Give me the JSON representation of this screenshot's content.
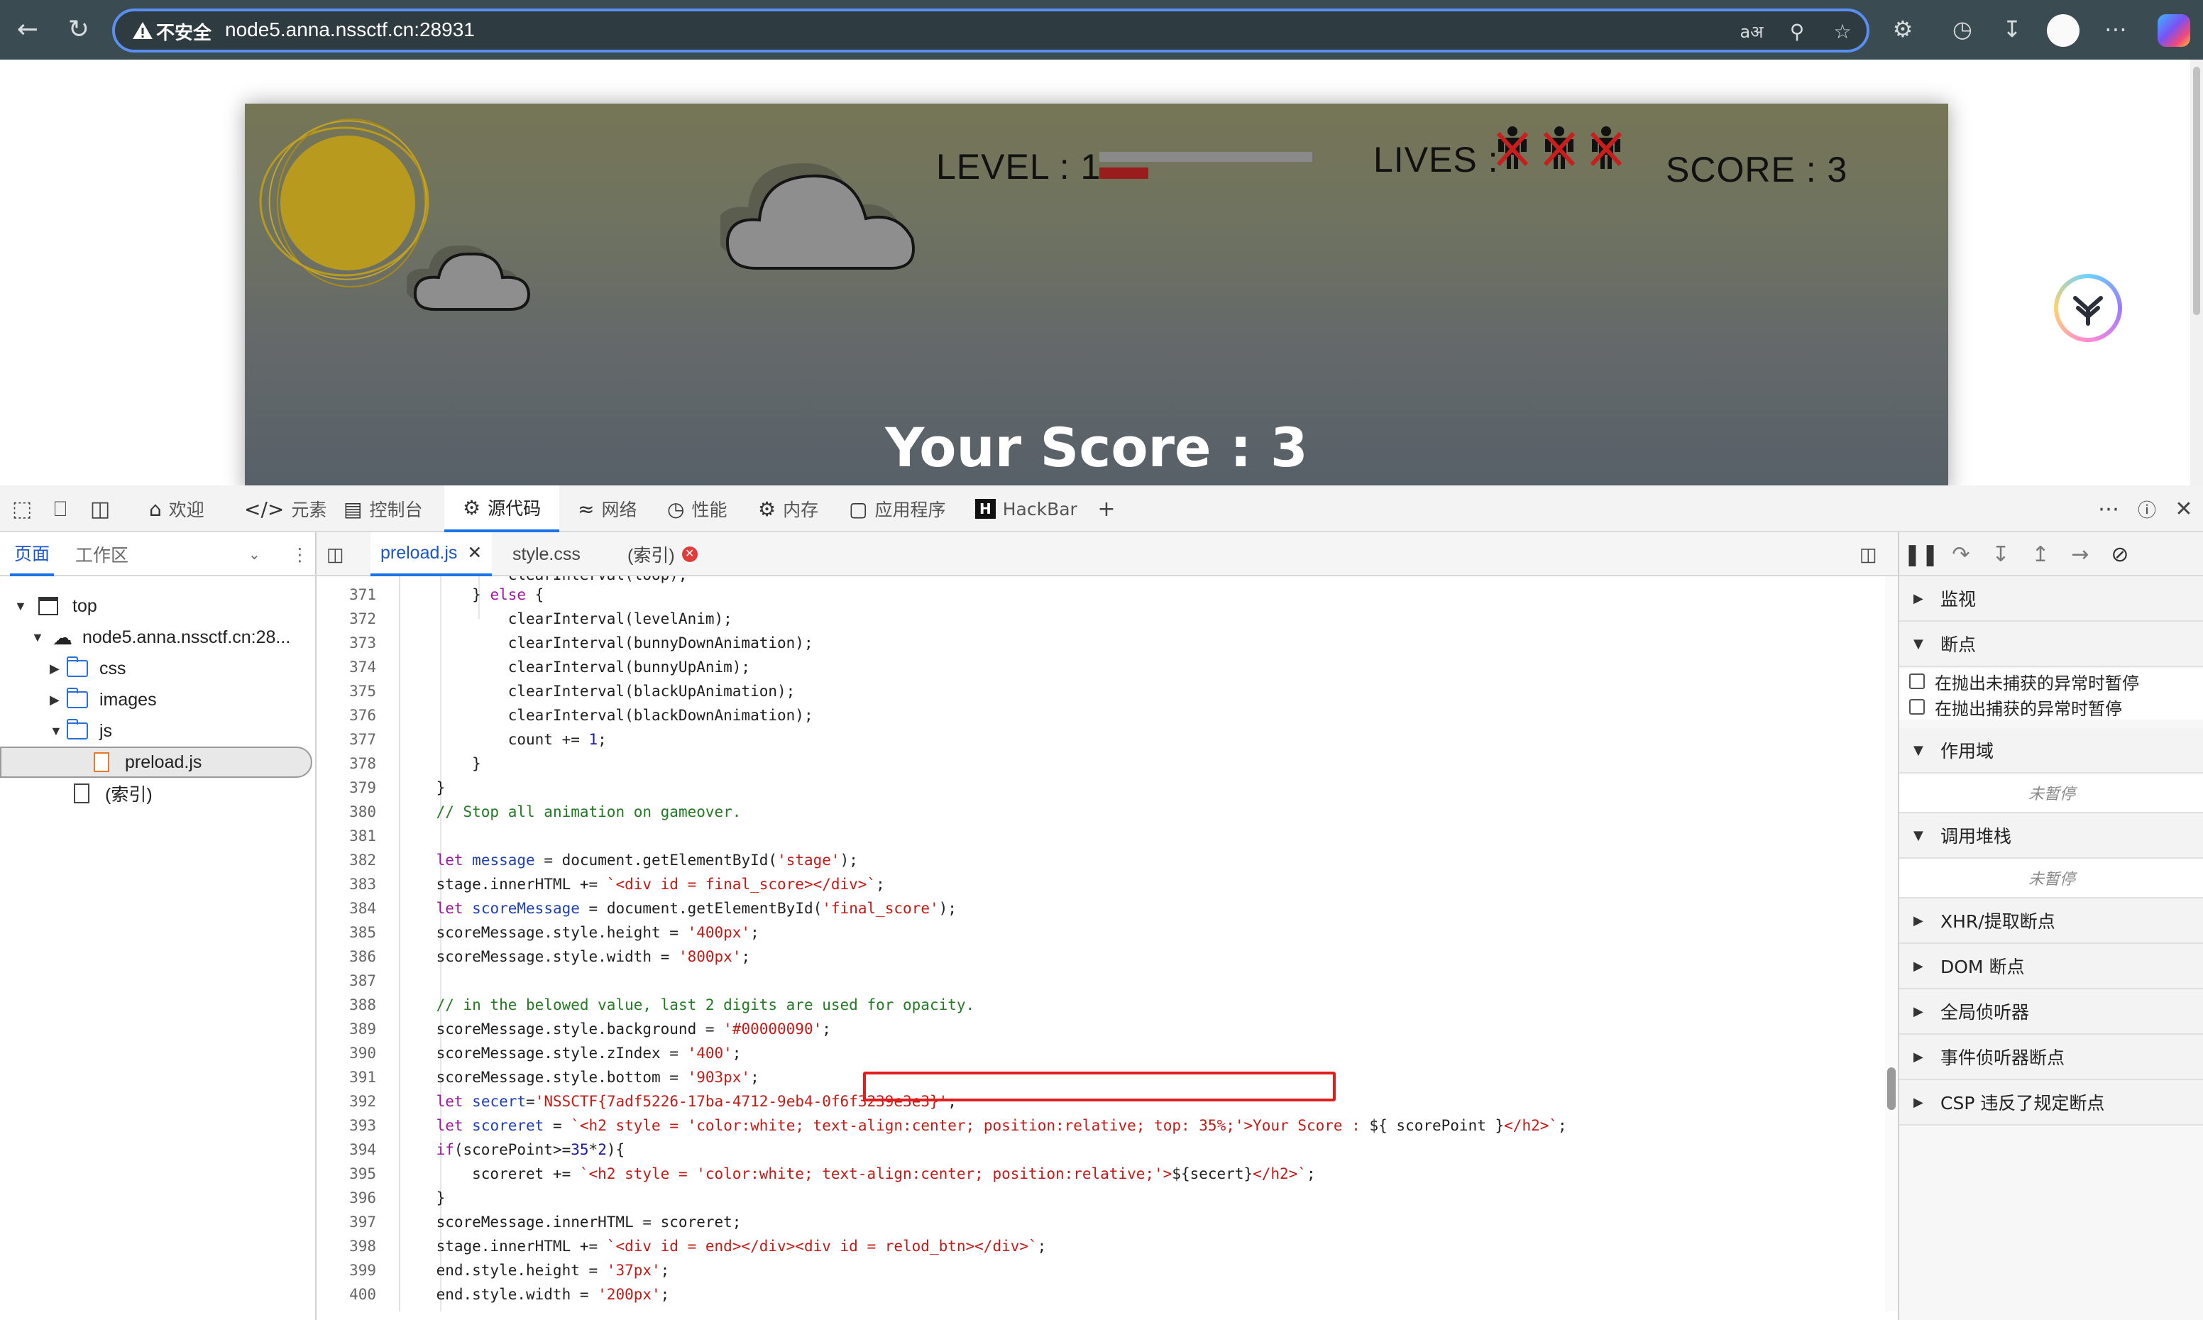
{
  "browser": {
    "insecure_label": "不安全",
    "url": "node5.anna.nssctf.cn:28931"
  },
  "game": {
    "level_label": "LEVEL : 1",
    "level_progress": 0.23,
    "lives_label": "LIVES :",
    "lives_count": 3,
    "score_label": "SCORE : 3",
    "final_score": "Your Score : 3"
  },
  "devtools": {
    "tabs": [
      {
        "label": "欢迎",
        "icon": "home-icon"
      },
      {
        "label": "元素",
        "icon": "code-icon"
      },
      {
        "label": "控制台",
        "icon": "console-icon"
      },
      {
        "label": "源代码",
        "icon": "sources-icon"
      },
      {
        "label": "网络",
        "icon": "wifi-icon"
      },
      {
        "label": "性能",
        "icon": "performance-icon"
      },
      {
        "label": "内存",
        "icon": "memory-icon"
      },
      {
        "label": "应用程序",
        "icon": "application-icon"
      },
      {
        "label": "HackBar",
        "icon": "hackbar-icon"
      }
    ],
    "tree_tabs": [
      "页面",
      "工作区"
    ],
    "tree": [
      {
        "label": "top"
      },
      {
        "label": "node5.anna.nssctf.cn:28..."
      },
      {
        "label": "css"
      },
      {
        "label": "images"
      },
      {
        "label": "js"
      },
      {
        "label": "preload.js"
      },
      {
        "label": "(索引)"
      }
    ],
    "editor_tabs": [
      "preload.js",
      "style.css",
      "(索引)"
    ],
    "line_numbers": [
      "371",
      "372",
      "373",
      "374",
      "375",
      "376",
      "377",
      "378",
      "379",
      "380",
      "381",
      "382",
      "383",
      "384",
      "385",
      "386",
      "387",
      "388",
      "389",
      "390",
      "391",
      "392",
      "393",
      "394",
      "395",
      "396",
      "397",
      "398",
      "399",
      "400"
    ],
    "debugger": {
      "sections": [
        "监视",
        "断点",
        "作用域",
        "调用堆栈",
        "XHR/提取断点",
        "DOM 断点",
        "全局侦听器",
        "事件侦听器断点",
        "CSP 违反了规定断点"
      ],
      "checkboxes": [
        "在抛出未捕获的异常时暂停",
        "在抛出捕获的异常时暂停"
      ],
      "not_paused": "未暂停"
    }
  },
  "colors": {
    "accent": "#1a73e8",
    "highlight": "#e11d1d",
    "keyword": "#a0179f",
    "string": "#c41a16",
    "comment": "#237a23"
  }
}
